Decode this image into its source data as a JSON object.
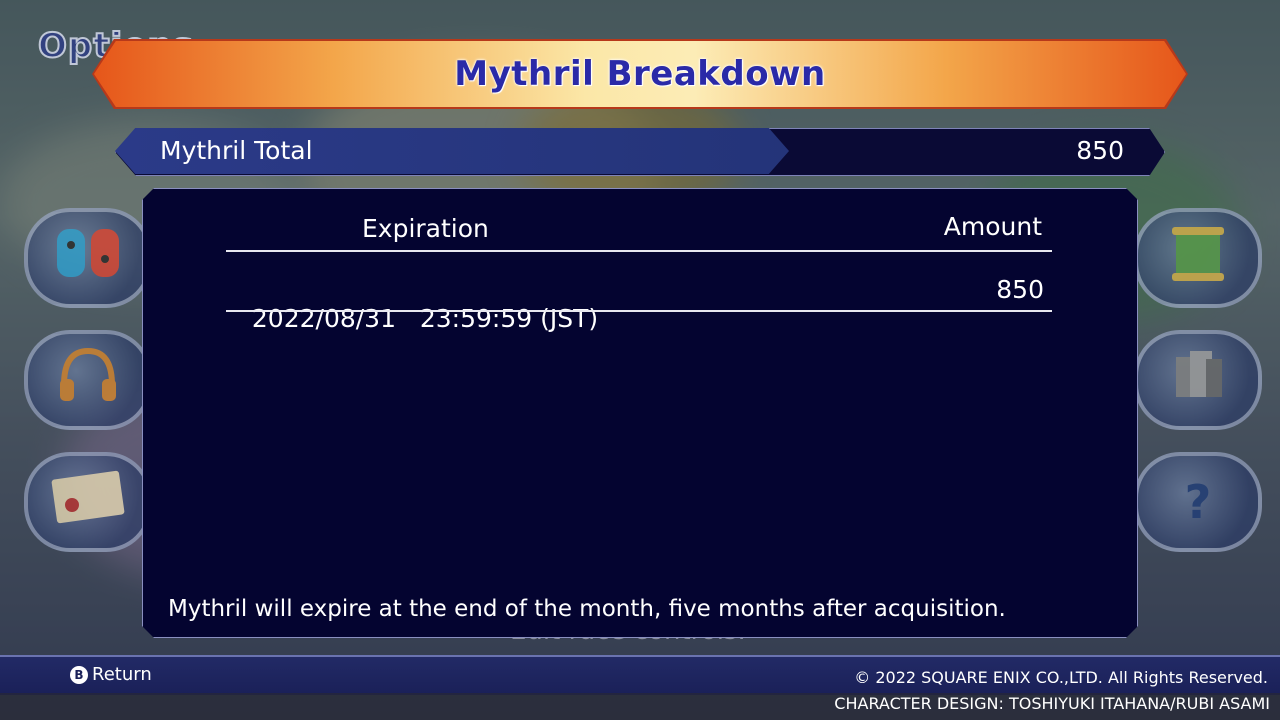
{
  "background": {
    "options_title": "Options",
    "hint_text": "Edit race controls."
  },
  "header": {
    "title": "Mythril Breakdown"
  },
  "total": {
    "label": "Mythril Total",
    "value": "850"
  },
  "table": {
    "headers": {
      "expiration": "Expiration",
      "amount": "Amount"
    },
    "rows": [
      {
        "date": "2022/08/31",
        "time": "23:59:59 (JST)",
        "amount": "850"
      }
    ]
  },
  "note": "Mythril will expire at the end of the month, five months after acquisition.",
  "footer": {
    "return_button_glyph": "B",
    "return_label": "Return",
    "copyright": "© 2022 SQUARE ENIX CO.,LTD. All Rights Reserved.",
    "credits": "CHARACTER DESIGN: TOSHIYUKI ITAHANA/RUBI ASAMI"
  },
  "colors": {
    "banner_accent": "#e6561a",
    "title_text": "#2a2aa8",
    "panel_bg": "#040430",
    "total_bar": "#2b3a88"
  },
  "icons": {
    "left": [
      "joycon-icon",
      "headphones-icon",
      "certificate-icon"
    ],
    "right": [
      "scroll-icon",
      "pages-icon",
      "help-icon"
    ]
  }
}
